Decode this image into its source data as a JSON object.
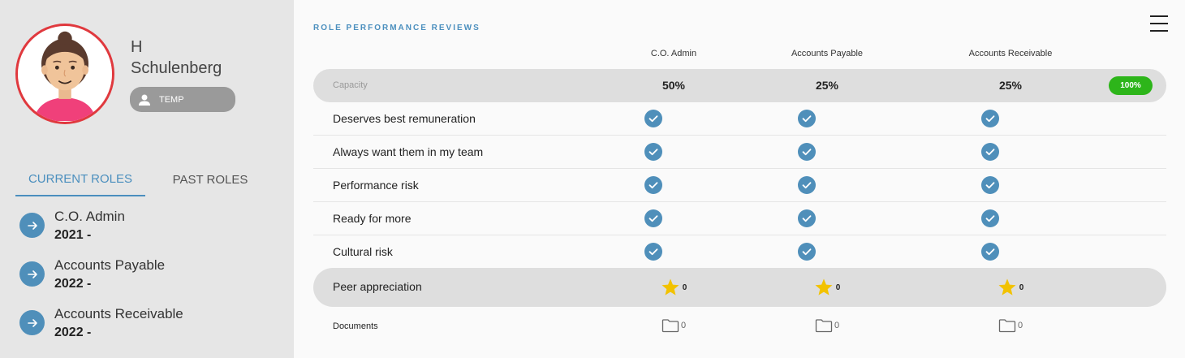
{
  "profile": {
    "first_name": "H",
    "last_name": "Schulenberg",
    "badge": "TEMP"
  },
  "tabs": [
    {
      "label": "CURRENT ROLES",
      "active": true
    },
    {
      "label": "PAST ROLES",
      "active": false
    }
  ],
  "roles": [
    {
      "name": "C.O. Admin",
      "year": "2021 -"
    },
    {
      "name": "Accounts Payable",
      "year": "2022 -"
    },
    {
      "name": "Accounts Receivable",
      "year": "2022 -"
    }
  ],
  "main": {
    "title": "ROLE PERFORMANCE REVIEWS",
    "columns": [
      "C.O. Admin",
      "Accounts Payable",
      "Accounts Receivable"
    ],
    "capacity": {
      "label": "Capacity",
      "values": [
        "50%",
        "25%",
        "25%"
      ],
      "total": "100%"
    },
    "criteria": [
      {
        "label": "Deserves best remuneration",
        "checked": [
          true,
          true,
          true
        ]
      },
      {
        "label": "Always want them in my team",
        "checked": [
          true,
          true,
          true
        ]
      },
      {
        "label": "Performance risk",
        "checked": [
          true,
          true,
          true
        ]
      },
      {
        "label": "Ready for more",
        "checked": [
          true,
          true,
          true
        ]
      },
      {
        "label": "Cultural risk",
        "checked": [
          true,
          true,
          true
        ]
      }
    ],
    "peer": {
      "label": "Peer appreciation",
      "counts": [
        "0",
        "0",
        "0"
      ]
    },
    "documents": {
      "label": "Documents",
      "counts": [
        "0",
        "0",
        "0"
      ]
    }
  },
  "colors": {
    "accent": "#4f8fba",
    "avatar_ring": "#e0393e",
    "total_pill": "#2db51a",
    "star": "#f2c200"
  },
  "icons": {
    "role_arrow": "arrow-right-icon",
    "check": "check-circle-icon",
    "star": "star-icon",
    "folder": "folder-icon",
    "menu": "hamburger-menu-icon",
    "badge": "person-icon"
  }
}
